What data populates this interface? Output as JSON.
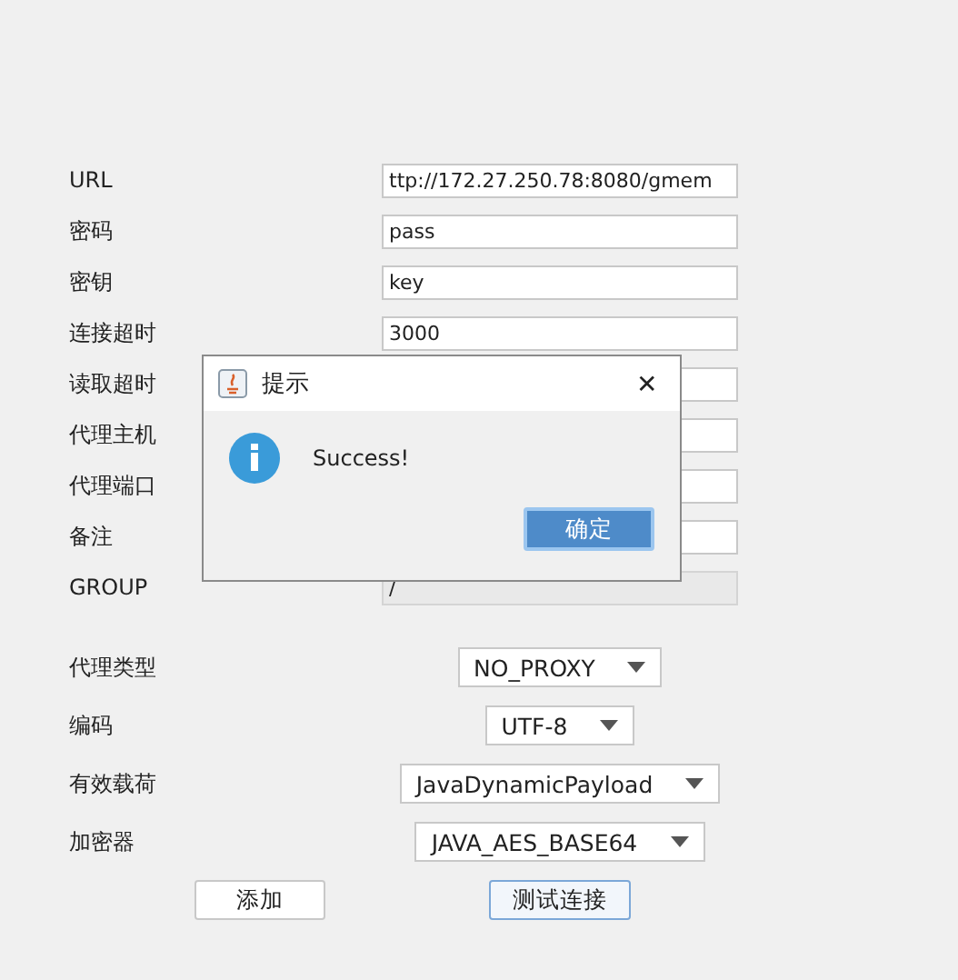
{
  "fields": [
    {
      "label": "URL",
      "value": "ttp://172.27.250.78:8080/gmem",
      "disabled": false
    },
    {
      "label": "密码",
      "value": "pass",
      "disabled": false
    },
    {
      "label": "密钥",
      "value": "key",
      "disabled": false
    },
    {
      "label": "连接超时",
      "value": "3000",
      "disabled": false
    },
    {
      "label": "读取超时",
      "disabled": false
    },
    {
      "label": "代理主机",
      "disabled": false
    },
    {
      "label": "代理端口",
      "disabled": false
    },
    {
      "label": "备注",
      "disabled": false
    },
    {
      "label": "GROUP",
      "value": "/",
      "disabled": true
    }
  ],
  "selects": [
    {
      "label": "代理类型",
      "value": "NO_PROXY"
    },
    {
      "label": "编码",
      "value": "UTF-8"
    },
    {
      "label": "有效载荷",
      "value": "JavaDynamicPayload"
    },
    {
      "label": "加密器",
      "value": "JAVA_AES_BASE64"
    }
  ],
  "buttons": [
    {
      "label": "添加",
      "focused": false
    },
    {
      "label": "测试连接",
      "focused": true
    }
  ],
  "dialog": {
    "title": "提示",
    "close": "✕",
    "message": "Success!",
    "button": "确定"
  }
}
